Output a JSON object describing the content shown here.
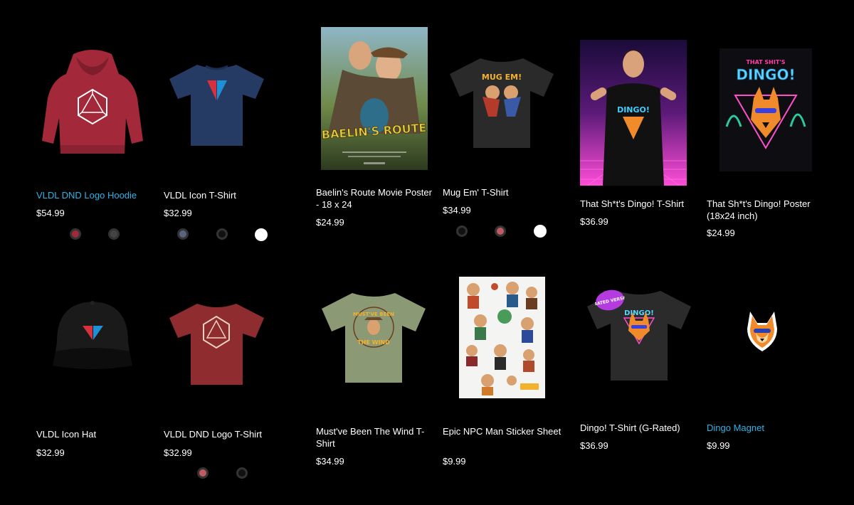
{
  "products": [
    {
      "title": "VLDL DND Logo Hoodie",
      "price": "$54.99"
    },
    {
      "title": "VLDL Icon T-Shirt",
      "price": "$32.99"
    },
    {
      "title": "Baelin's Route Movie Poster - 18 x 24",
      "price": "$24.99",
      "art": "BAELIN'S ROUTE"
    },
    {
      "title": "Mug Em' T-Shirt",
      "price": "$34.99",
      "art": "MUG EM!"
    },
    {
      "title": "That Sh*t's Dingo! T-Shirt",
      "price": "$36.99",
      "art": "DINGO!"
    },
    {
      "title": "That Sh*t's Dingo! Poster (18x24 inch)",
      "price": "$24.99",
      "art_top": "THAT SHIT'S",
      "art": "DINGO!"
    },
    {
      "title": "VLDL Icon Hat",
      "price": "$32.99"
    },
    {
      "title": "VLDL DND Logo T-Shirt",
      "price": "$32.99"
    },
    {
      "title": "Must've Been The Wind T-Shirt",
      "price": "$34.99",
      "art_top": "MUST'VE BEEN",
      "art": "THE WIND"
    },
    {
      "title": "Epic NPC Man Sticker Sheet",
      "price": "$9.99"
    },
    {
      "title": "Dingo! T-Shirt (G-Rated)",
      "price": "$36.99",
      "badge": "G-RATED VERSION",
      "art": "DINGO!"
    },
    {
      "title": "Dingo Magnet",
      "price": "$9.99"
    }
  ],
  "colors": {
    "link": "#2bb3e6",
    "background": "#000000"
  }
}
